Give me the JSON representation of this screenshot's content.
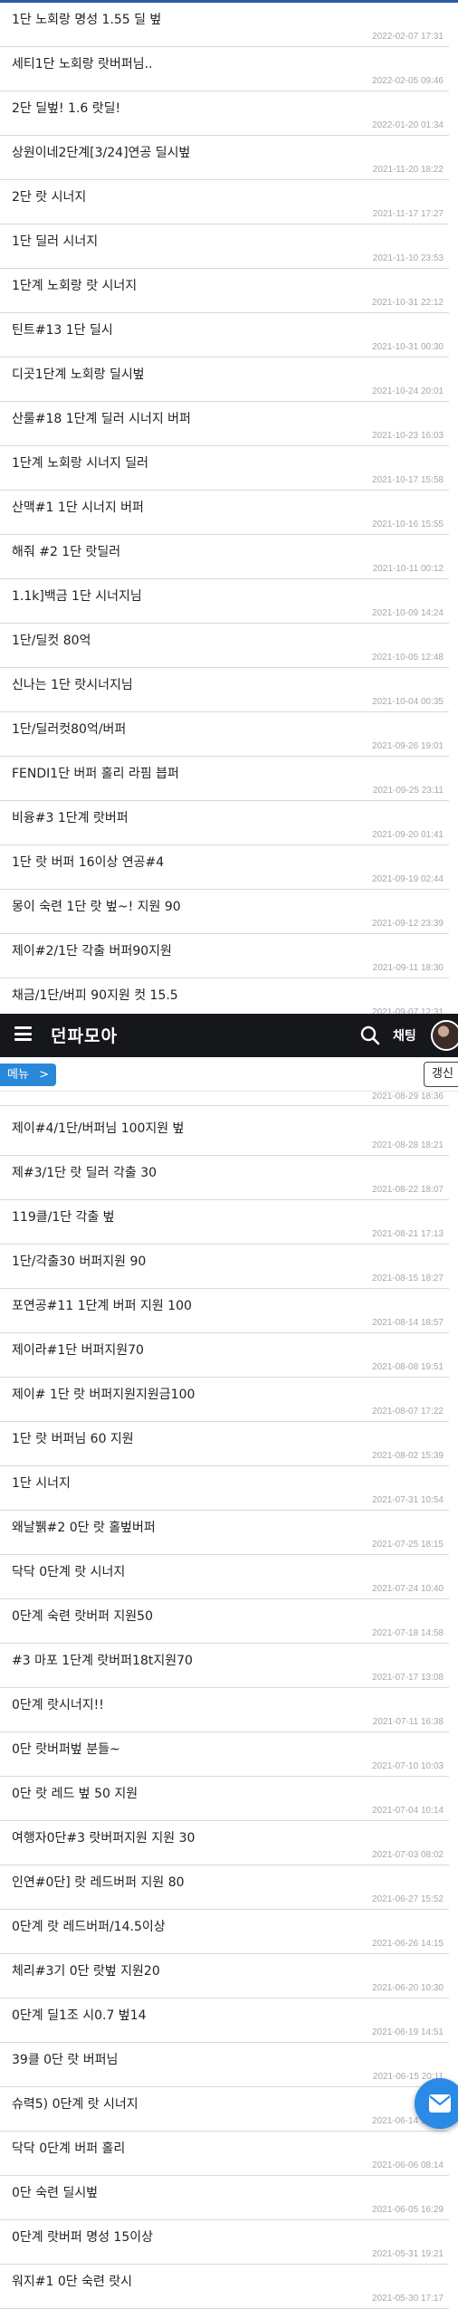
{
  "header": {
    "logo": "던파모아",
    "chat_label": "채팅",
    "icons": [
      "menu-icon",
      "search-icon",
      "avatar",
      "mail-icon"
    ],
    "colors": {
      "header_bg": "#16171b",
      "accent": "#2a88d8"
    }
  },
  "subbar": {
    "menu_label": "메뉴",
    "menu_chevron": ">",
    "refresh_label": "갱신"
  },
  "posts_top": [
    {
      "title": "1단 노회랑 명성 1.55 딜 벞",
      "date": "2022-02-07 17:31"
    },
    {
      "title": "세티1단 노회랑 랏버퍼님..",
      "date": "2022-02-05 09:46"
    },
    {
      "title": "2단 딜벞! 1.6 랏딜!",
      "date": "2022-01-20 01:34"
    },
    {
      "title": "상원이네2단계[3/24]연공 딜시벞",
      "date": "2021-11-20 18:22"
    },
    {
      "title": "2단 랏 시너지",
      "date": "2021-11-17 17:27"
    },
    {
      "title": "1단 딜러 시너지",
      "date": "2021-11-10 23:53"
    },
    {
      "title": "1단계 노회랑 랏 시너지",
      "date": "2021-10-31 22:12"
    },
    {
      "title": "틴트#13 1단 딜시",
      "date": "2021-10-31 00:30"
    },
    {
      "title": "디곳1단계 노회랑 딜시벞",
      "date": "2021-10-24 20:01"
    },
    {
      "title": "산룰#18 1단계 딜러 시너지 버퍼",
      "date": "2021-10-23 16:03"
    },
    {
      "title": "1단계 노회랑 시너지 딜러",
      "date": "2021-10-17 15:58"
    },
    {
      "title": "산맥#1 1단 시너지 버퍼",
      "date": "2021-10-16 15:55"
    },
    {
      "title": "해줘 #2 1단 랏딜러",
      "date": "2021-10-11 00:12"
    },
    {
      "title": "1.1k]백금 1단 시너지님",
      "date": "2021-10-09 14:24"
    },
    {
      "title": "1단/딜컷 80억",
      "date": "2021-10-05 12:48"
    },
    {
      "title": "신나는 1단 랏시너지님",
      "date": "2021-10-04 00:35"
    },
    {
      "title": "1단/딜러컷80억/버퍼",
      "date": "2021-09-26 19:01"
    },
    {
      "title": "FENDI1단 버퍼 홀리 라핌 븝퍼",
      "date": "2021-09-25 23:11"
    },
    {
      "title": "비융#3 1단계 랏버퍼",
      "date": "2021-09-20 01:41"
    },
    {
      "title": "1단 랏 버퍼 16이상 연공#4",
      "date": "2021-09-19 02:44"
    },
    {
      "title": "몽이 숙련 1단 랏 벞~! 지원 90",
      "date": "2021-09-12 23:39"
    },
    {
      "title": "제이#2/1단 각출 버퍼90지원",
      "date": "2021-09-11 18:30"
    },
    {
      "title": "채금/1단/버피 90지원 컷 15.5",
      "date": "2021-09-07 12:31"
    }
  ],
  "cut_date": "2021-08-29 18:36",
  "posts_bottom": [
    {
      "title": "제이#4/1단/버퍼님 100지원 벞",
      "date": "2021-08-28 18:21"
    },
    {
      "title": "제#3/1단 랏 딜러 각출 30",
      "date": "2021-08-22 18:07"
    },
    {
      "title": "119클/1단 각출 벞",
      "date": "2021-08-21 17:13"
    },
    {
      "title": "1단/각출30 버퍼지원 90",
      "date": "2021-08-15 18:27"
    },
    {
      "title": "포연공#11 1단계 버퍼 지원 100",
      "date": "2021-08-14 18:57"
    },
    {
      "title": "제이라#1단 버퍼지원70",
      "date": "2021-08-08 19:51"
    },
    {
      "title": "제이# 1단 랏 버퍼지원지원금100",
      "date": "2021-08-07 17:22"
    },
    {
      "title": "1단 랏 버퍼님 60 지원",
      "date": "2021-08-02 15:39"
    },
    {
      "title": "1단 시너지",
      "date": "2021-07-31 10:54"
    },
    {
      "title": "왜날뷁#2 0단 랏 홀벞버퍼",
      "date": "2021-07-25 18:15"
    },
    {
      "title": "닥닥 0단계 랏 시너지",
      "date": "2021-07-24 10:40"
    },
    {
      "title": "0단계 숙련 랏버퍼 지원50",
      "date": "2021-07-18 14:58"
    },
    {
      "title": "#3 마포 1단계 랏버퍼18t지원70",
      "date": "2021-07-17 13:08"
    },
    {
      "title": "0단계 랏시너지!!",
      "date": "2021-07-11 16:38"
    },
    {
      "title": "0단 랏버퍼벞 분들~",
      "date": "2021-07-10 10:03"
    },
    {
      "title": "0단 랏 레드 벞 50 지원",
      "date": "2021-07-04 10:14"
    },
    {
      "title": "여행자0단#3 랏버퍼지원 지원 30",
      "date": "2021-07-03 08:02"
    },
    {
      "title": "인연#0단] 랏 레드버퍼 지원 80",
      "date": "2021-06-27 15:52"
    },
    {
      "title": "0단계 랏 레드버퍼/14.5이상",
      "date": "2021-06-26 14:15"
    },
    {
      "title": "체리#3기 0단 랏벞 지원20",
      "date": "2021-06-20 10:30"
    },
    {
      "title": "0단계 딜1조 시0.7 벞14",
      "date": "2021-06-19 14:51"
    },
    {
      "title": "39클 0단 랏 버퍼님",
      "date": "2021-06-15 20:11"
    },
    {
      "title": "슈력5) 0단계 랏 시너지",
      "date": "2021-06-14 16:02"
    },
    {
      "title": "닥닥 0단계 버퍼 홀리",
      "date": "2021-06-06 08:14"
    },
    {
      "title": "0단 숙련 딜시벞",
      "date": "2021-06-05 16:29"
    },
    {
      "title": "0단계 랏버퍼 명성 15이상",
      "date": "2021-05-31 19:21"
    },
    {
      "title": "워지#1 0단 숙련 랏시",
      "date": "2021-05-30 17:17"
    }
  ]
}
